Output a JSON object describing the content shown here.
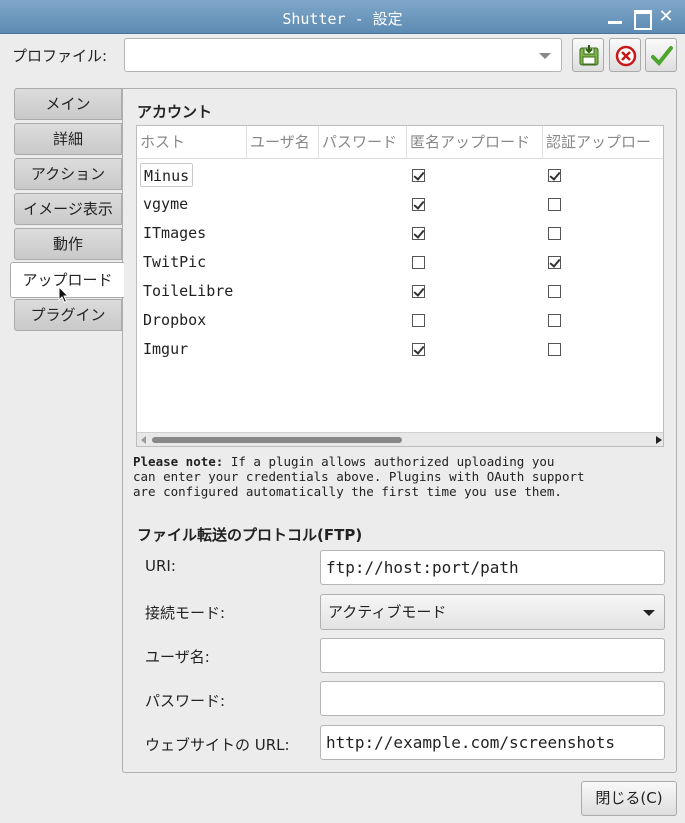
{
  "window": {
    "title": "Shutter - 設定"
  },
  "profile": {
    "label": "プロファイル:",
    "value": ""
  },
  "tabs": [
    {
      "label": "メイン"
    },
    {
      "label": "詳細"
    },
    {
      "label": "アクション"
    },
    {
      "label": "イメージ表示"
    },
    {
      "label": "動作"
    },
    {
      "label": "アップロード",
      "active": true
    },
    {
      "label": "プラグイン"
    }
  ],
  "accounts": {
    "title": "アカウント",
    "columns": [
      "ホスト",
      "ユーザ名",
      "パスワード",
      "匿名アップロード",
      "認証アップロー"
    ],
    "rows": [
      {
        "host": "Minus",
        "anonymous": true,
        "authenticated": true
      },
      {
        "host": "vgyme",
        "anonymous": true,
        "authenticated": false
      },
      {
        "host": "ITmages",
        "anonymous": true,
        "authenticated": false
      },
      {
        "host": "TwitPic",
        "anonymous": false,
        "authenticated": true
      },
      {
        "host": "ToileLibre",
        "anonymous": true,
        "authenticated": false
      },
      {
        "host": "Dropbox",
        "anonymous": false,
        "authenticated": false
      },
      {
        "host": "Imgur",
        "anonymous": true,
        "authenticated": false
      }
    ]
  },
  "note": {
    "bold": "Please note:",
    "line1": " If a plugin allows authorized uploading you",
    "line2": "can enter your credentials above. Plugins with OAuth support",
    "line3": "are configured automatically the first time you use them."
  },
  "ftp": {
    "title": "ファイル転送のプロトコル(FTP)",
    "uri_label": "URI:",
    "uri_value": "ftp://host:port/path",
    "mode_label": "接続モード:",
    "mode_value": "アクティブモード",
    "user_label": "ユーザ名:",
    "user_value": "",
    "password_label": "パスワード:",
    "password_value": "",
    "website_label": "ウェブサイトの URL:",
    "website_value": "http://example.com/screenshots"
  },
  "footer": {
    "close_label": "閉じる(C)"
  },
  "colors": {
    "titlebar": "#6f9ac0",
    "panel": "#ececec",
    "check": "#333333"
  }
}
